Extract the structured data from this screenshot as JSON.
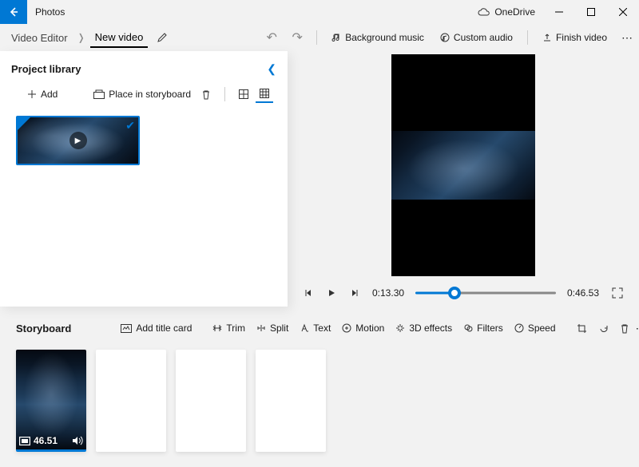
{
  "titlebar": {
    "app_name": "Photos",
    "onedrive_label": "OneDrive"
  },
  "breadcrumb": {
    "root": "Video Editor",
    "current": "New video"
  },
  "topbar": {
    "bg_music": "Background music",
    "custom_audio": "Custom audio",
    "finish": "Finish video"
  },
  "library": {
    "title": "Project library",
    "add": "Add",
    "place": "Place in storyboard"
  },
  "player": {
    "current_time": "0:13.30",
    "total_time": "0:46.53",
    "progress_pct": 28
  },
  "storyboard": {
    "title": "Storyboard",
    "add_title_card": "Add title card",
    "trim": "Trim",
    "split": "Split",
    "text": "Text",
    "motion": "Motion",
    "effects3d": "3D effects",
    "filters": "Filters",
    "speed": "Speed",
    "clip_duration": "46.51"
  }
}
